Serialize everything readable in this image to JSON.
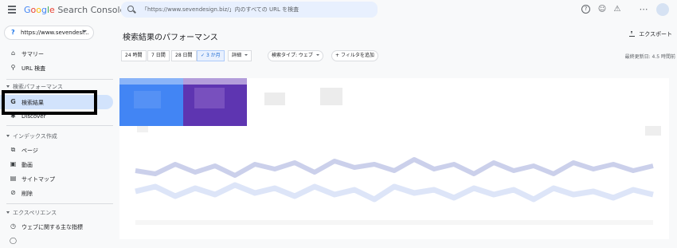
{
  "header": {
    "logo_google": "Google",
    "logo_product": "Search Console",
    "search_placeholder": "「https://www.sevendesign.biz/」内のすべての URL を検査",
    "icons": [
      "help-icon",
      "users-icon",
      "notifications-icon",
      "apps-icon",
      "account-avatar"
    ]
  },
  "sidebar": {
    "property_icon": "?",
    "property": "https://www.sevendesi...",
    "items_top": [
      {
        "label": "サマリー",
        "icon": "home-icon"
      },
      {
        "label": "URL 検査",
        "icon": "search-icon"
      }
    ],
    "section_performance": "検索パフォーマンス",
    "items_performance": [
      {
        "label": "検索結果",
        "icon": "google-g-icon"
      },
      {
        "label": "Discover",
        "icon": "asterisk-icon"
      }
    ],
    "section_index": "インデックス作成",
    "items_index": [
      {
        "label": "ページ",
        "icon": "pages-icon"
      },
      {
        "label": "動画",
        "icon": "video-icon"
      },
      {
        "label": "サイトマップ",
        "icon": "sitemap-icon"
      },
      {
        "label": "削除",
        "icon": "removal-icon"
      }
    ],
    "section_experience": "エクスペリエンス",
    "items_experience": [
      {
        "label": "ウェブに関する主な指標",
        "icon": "speed-icon"
      }
    ]
  },
  "main": {
    "title": "検索結果のパフォーマンス",
    "export_label": "エクスポート",
    "filters": {
      "ranges": [
        "24 時間",
        "7 日間",
        "28 日間",
        "3 か月"
      ],
      "selected_range": "3 か月",
      "detail": "詳細",
      "search_type": "検索タイプ: ウェブ",
      "add_filter": "フィルタを追加"
    },
    "updated": "最終更新日: 4.5 時間前"
  },
  "colors": {
    "clicks": "#4285f4",
    "impressions": "#5e35b1",
    "active_nav": "#d2e3fc",
    "chip_selected": "#e8f0fe"
  }
}
